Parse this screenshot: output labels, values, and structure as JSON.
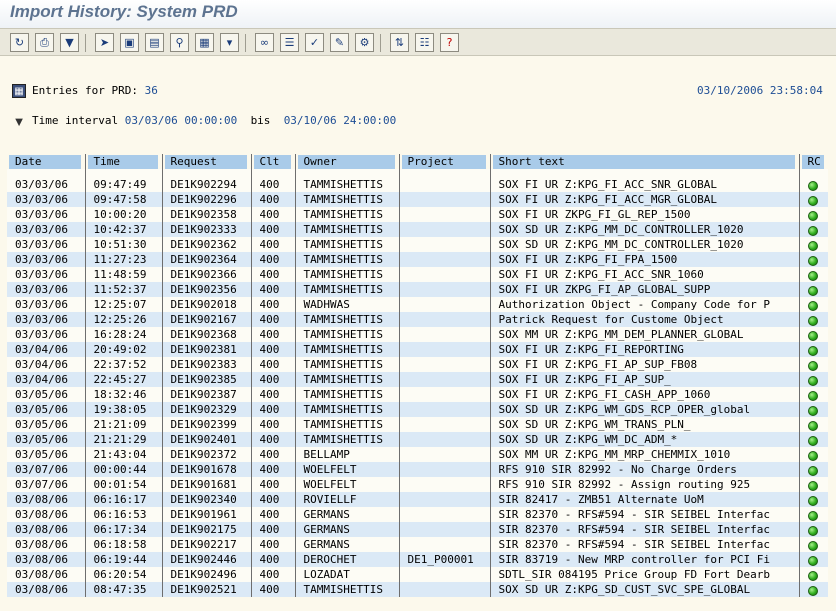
{
  "window": {
    "title": "Import History: System PRD"
  },
  "toolbar": {
    "icons": [
      "refresh-icon",
      "print-icon",
      "filter-icon",
      "cursor-icon",
      "detail-icon",
      "document-icon",
      "zoom-icon",
      "export-icon",
      "funnel-icon",
      "glasses-icon",
      "list-icon",
      "choose-icon",
      "edit-icon",
      "settings-icon",
      "sort-icon",
      "table-icon",
      "help-icon"
    ]
  },
  "info": {
    "entries_label": "Entries for PRD:",
    "entries_count": "36",
    "datetime": "03/10/2006 23:58:04",
    "interval_label": "Time interval",
    "interval_from": "03/03/06 00:00:00",
    "interval_bis": "bis",
    "interval_to": "03/10/06 24:00:00"
  },
  "table": {
    "headers": [
      "Date",
      "Time",
      "Request",
      "Clt",
      "Owner",
      "Project",
      "Short text",
      "RC"
    ],
    "rows": [
      [
        "03/03/06",
        "09:47:49",
        "DE1K902294",
        "400",
        "TAMMISHETTIS",
        "",
        "SOX FI UR Z:KPG_FI_ACC_SNR_GLOBAL"
      ],
      [
        "03/03/06",
        "09:47:58",
        "DE1K902296",
        "400",
        "TAMMISHETTIS",
        "",
        "SOX FI UR Z:KPG_FI_ACC_MGR_GLOBAL"
      ],
      [
        "03/03/06",
        "10:00:20",
        "DE1K902358",
        "400",
        "TAMMISHETTIS",
        "",
        "SOX FI UR ZKPG_FI_GL_REP_1500"
      ],
      [
        "03/03/06",
        "10:42:37",
        "DE1K902333",
        "400",
        "TAMMISHETTIS",
        "",
        "SOX SD UR Z:KPG_MM_DC_CONTROLLER_1020"
      ],
      [
        "03/03/06",
        "10:51:30",
        "DE1K902362",
        "400",
        "TAMMISHETTIS",
        "",
        "SOX SD UR Z:KPG_MM_DC_CONTROLLER_1020"
      ],
      [
        "03/03/06",
        "11:27:23",
        "DE1K902364",
        "400",
        "TAMMISHETTIS",
        "",
        "SOX FI UR Z:KPG_FI_FPA_1500"
      ],
      [
        "03/03/06",
        "11:48:59",
        "DE1K902366",
        "400",
        "TAMMISHETTIS",
        "",
        "SOX FI UR Z:KPG_FI_ACC_SNR_1060"
      ],
      [
        "03/03/06",
        "11:52:37",
        "DE1K902356",
        "400",
        "TAMMISHETTIS",
        "",
        "SOX FI UR ZKPG_FI_AP_GLOBAL_SUPP"
      ],
      [
        "03/03/06",
        "12:25:07",
        "DE1K902018",
        "400",
        "WADHWAS",
        "",
        "Authorization Object - Company Code for P"
      ],
      [
        "03/03/06",
        "12:25:26",
        "DE1K902167",
        "400",
        "TAMMISHETTIS",
        "",
        "Patrick Request for Custome Object"
      ],
      [
        "03/03/06",
        "16:28:24",
        "DE1K902368",
        "400",
        "TAMMISHETTIS",
        "",
        "SOX MM UR Z:KPG_MM_DEM_PLANNER_GLOBAL"
      ],
      [
        "03/04/06",
        "20:49:02",
        "DE1K902381",
        "400",
        "TAMMISHETTIS",
        "",
        "SOX FI UR Z:KPG_FI_REPORTING"
      ],
      [
        "03/04/06",
        "22:37:52",
        "DE1K902383",
        "400",
        "TAMMISHETTIS",
        "",
        "SOX FI UR Z:KPG_FI_AP_SUP_FB08"
      ],
      [
        "03/04/06",
        "22:45:27",
        "DE1K902385",
        "400",
        "TAMMISHETTIS",
        "",
        "SOX FI UR Z:KPG_FI_AP_SUP_"
      ],
      [
        "03/05/06",
        "18:32:46",
        "DE1K902387",
        "400",
        "TAMMISHETTIS",
        "",
        "SOX FI UR Z:KPG_FI_CASH_APP_1060"
      ],
      [
        "03/05/06",
        "19:38:05",
        "DE1K902329",
        "400",
        "TAMMISHETTIS",
        "",
        "SOX SD UR Z:KPG_WM_GDS_RCP_OPER_global"
      ],
      [
        "03/05/06",
        "21:21:09",
        "DE1K902399",
        "400",
        "TAMMISHETTIS",
        "",
        "SOX SD UR Z:KPG_WM_TRANS_PLN_"
      ],
      [
        "03/05/06",
        "21:21:29",
        "DE1K902401",
        "400",
        "TAMMISHETTIS",
        "",
        "SOX SD UR Z:KPG_WM_DC_ADM_*"
      ],
      [
        "03/05/06",
        "21:43:04",
        "DE1K902372",
        "400",
        "BELLAMP",
        "",
        "SOX MM UR Z:KPG_MM_MRP_CHEMMIX_1010"
      ],
      [
        "03/07/06",
        "00:00:44",
        "DE1K901678",
        "400",
        "WOELFELT",
        "",
        "RFS 910 SIR 82992 - No Charge Orders"
      ],
      [
        "03/07/06",
        "00:01:54",
        "DE1K901681",
        "400",
        "WOELFELT",
        "",
        "RFS 910 SIR 82992  - Assign routing 925"
      ],
      [
        "03/08/06",
        "06:16:17",
        "DE1K902340",
        "400",
        "ROVIELLF",
        "",
        "SIR 82417 - ZMB51 Alternate UoM"
      ],
      [
        "03/08/06",
        "06:16:53",
        "DE1K901961",
        "400",
        "GERMANS",
        "",
        "SIR 82370 - RFS#594 - SIR SEIBEL Interfac"
      ],
      [
        "03/08/06",
        "06:17:34",
        "DE1K902175",
        "400",
        "GERMANS",
        "",
        "SIR 82370 - RFS#594 - SIR SEIBEL Interfac"
      ],
      [
        "03/08/06",
        "06:18:58",
        "DE1K902217",
        "400",
        "GERMANS",
        "",
        "SIR 82370 - RFS#594 - SIR SEIBEL Interfac"
      ],
      [
        "03/08/06",
        "06:19:44",
        "DE1K902446",
        "400",
        "DEROCHET",
        "DE1_P00001",
        "SIR 83719 - New MRP controller for PCI Fi"
      ],
      [
        "03/08/06",
        "06:20:54",
        "DE1K902496",
        "400",
        "LOZADAT",
        "",
        "SDTL_SIR 084195 Price Group FD Fort Dearb"
      ],
      [
        "03/08/06",
        "08:47:35",
        "DE1K902521",
        "400",
        "TAMMISHETTIS",
        "",
        "SOX SD UR Z:KPG_SD_CUST_SVC_SPE_GLOBAL"
      ]
    ]
  }
}
